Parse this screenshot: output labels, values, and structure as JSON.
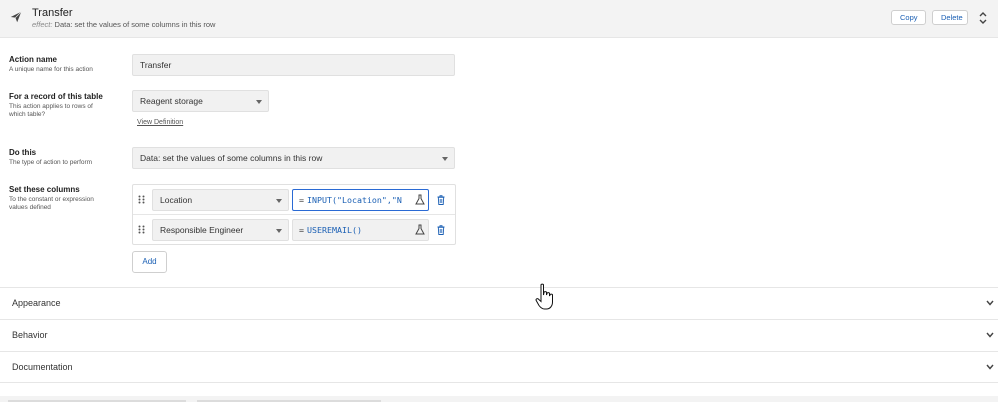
{
  "header": {
    "title": "Transfer",
    "subtitle_prefix": "effect:",
    "subtitle": "Data: set the values of some columns in this row",
    "copy_label": "Copy",
    "delete_label": "Delete",
    "icon": "paper-plane-icon"
  },
  "form": {
    "action_name": {
      "label": "Action name",
      "description": "A unique name for this action",
      "value": "Transfer"
    },
    "table": {
      "label": "For a record of this table",
      "description": "This action applies to rows of which table?",
      "value": "Reagent storage",
      "view_definition": "View Definition"
    },
    "do_this": {
      "label": "Do this",
      "description": "The type of action to perform",
      "value": "Data: set the values of some columns in this row"
    },
    "set_columns": {
      "label": "Set these columns",
      "description": "To the constant or expression values defined",
      "rows": [
        {
          "column": "Location",
          "equals": "=",
          "expression": "INPUT(\"Location\",\"N"
        },
        {
          "column": "Responsible Engineer",
          "equals": "=",
          "expression": "USEREMAIL()"
        }
      ],
      "add_label": "Add"
    }
  },
  "sections": [
    {
      "label": "Appearance"
    },
    {
      "label": "Behavior"
    },
    {
      "label": "Documentation"
    }
  ],
  "colors": {
    "accent": "#1a5fb4",
    "header_bg": "#f3f3f3",
    "field_bg": "#f1f1f1"
  }
}
